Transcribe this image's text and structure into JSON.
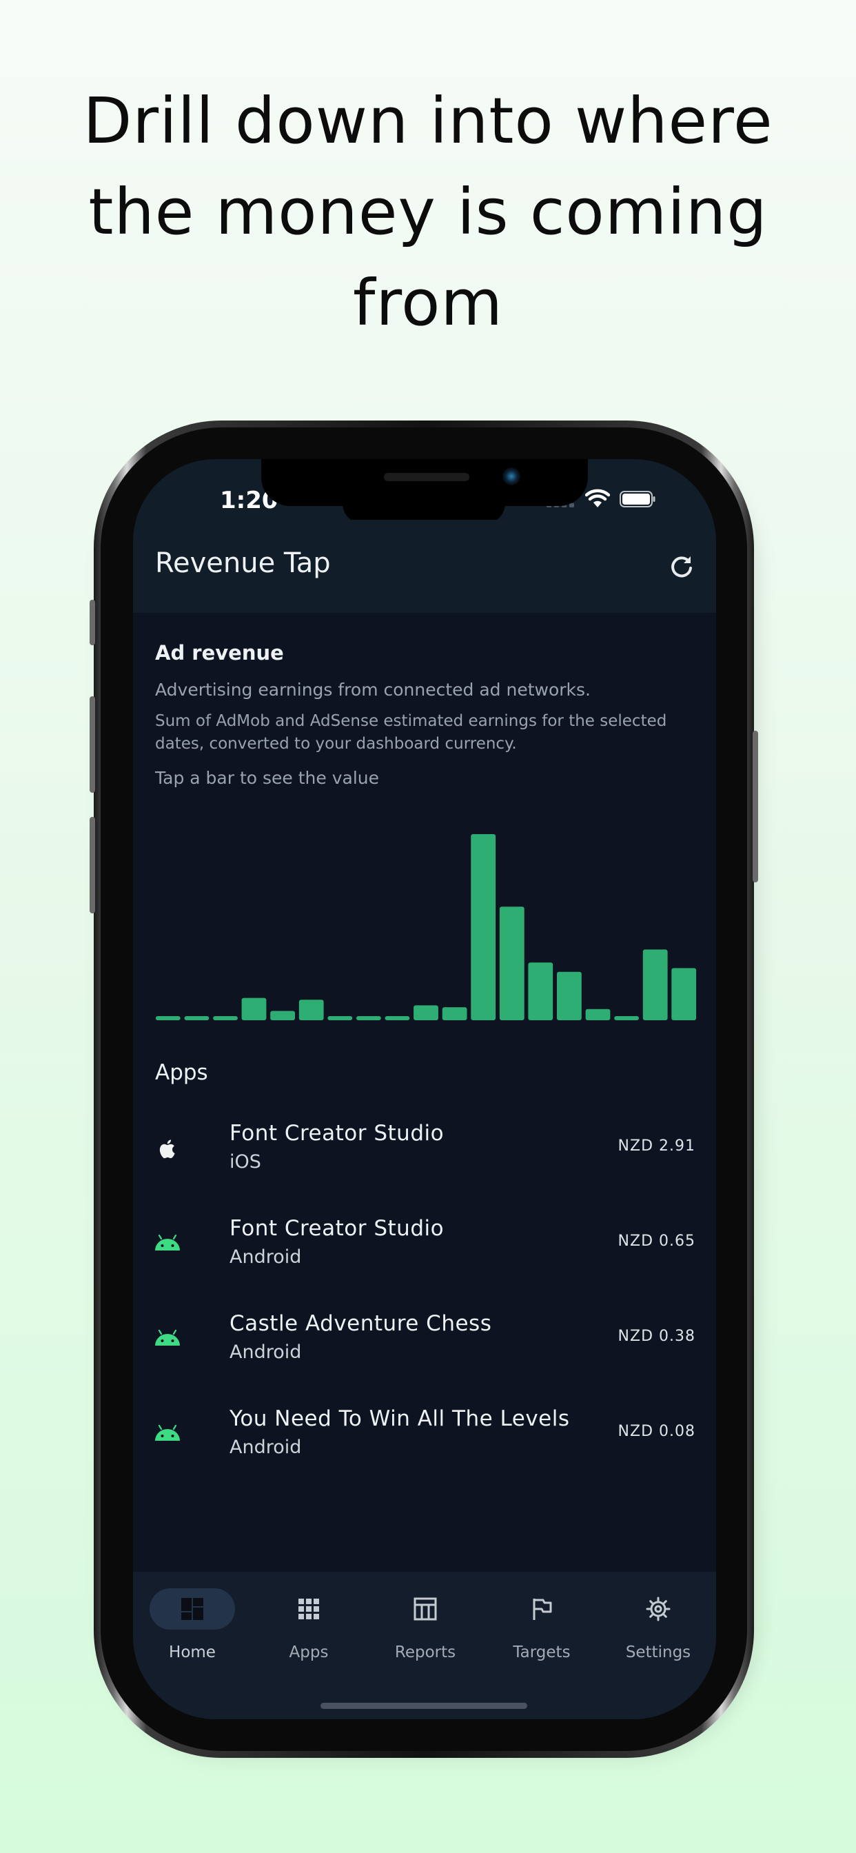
{
  "headline": [
    "Drill down into where",
    "the money is coming",
    "from"
  ],
  "status_bar": {
    "time": "1:20"
  },
  "app_bar": {
    "title": "Revenue Tap",
    "refresh_icon": "refresh-icon"
  },
  "ad_revenue": {
    "title": "Ad revenue",
    "subtitle": "Advertising earnings from connected ad networks.",
    "description": "Sum of AdMob and AdSense estimated earnings for the selected dates, converted to your dashboard currency.",
    "hint": "Tap a bar to see the value"
  },
  "chart_data": {
    "type": "bar",
    "title": "",
    "xlabel": "",
    "ylabel": "",
    "grid": false,
    "legend": "none",
    "color": "#2fae74",
    "values": [
      0.02,
      0.02,
      0.02,
      0.12,
      0.05,
      0.11,
      0.02,
      0.02,
      0.02,
      0.08,
      0.07,
      1.0,
      0.61,
      0.31,
      0.26,
      0.06,
      0.02,
      0.38,
      0.28
    ]
  },
  "apps": {
    "title": "Apps",
    "items": [
      {
        "name": "Font Creator Studio",
        "platform": "iOS",
        "amount": "NZD 2.91",
        "icon": "apple-icon"
      },
      {
        "name": "Font Creator Studio",
        "platform": "Android",
        "amount": "NZD 0.65",
        "icon": "android-icon"
      },
      {
        "name": "Castle Adventure Chess",
        "platform": "Android",
        "amount": "NZD 0.38",
        "icon": "android-icon"
      },
      {
        "name": "You Need To Win All The Levels",
        "platform": "Android",
        "amount": "NZD 0.08",
        "icon": "android-icon"
      }
    ]
  },
  "bottom_nav": {
    "items": [
      {
        "label": "Home",
        "icon": "dashboard-icon",
        "active": true
      },
      {
        "label": "Apps",
        "icon": "grid-icon",
        "active": false
      },
      {
        "label": "Reports",
        "icon": "table-icon",
        "active": false
      },
      {
        "label": "Targets",
        "icon": "flag-icon",
        "active": false
      },
      {
        "label": "Settings",
        "icon": "gear-icon",
        "active": false
      }
    ]
  },
  "colors": {
    "accent_green": "#2fae74",
    "android_green": "#3ddc84",
    "screen_bg": "#0d1320",
    "appbar_bg": "#111d28",
    "nav_bg": "#141d2b"
  }
}
